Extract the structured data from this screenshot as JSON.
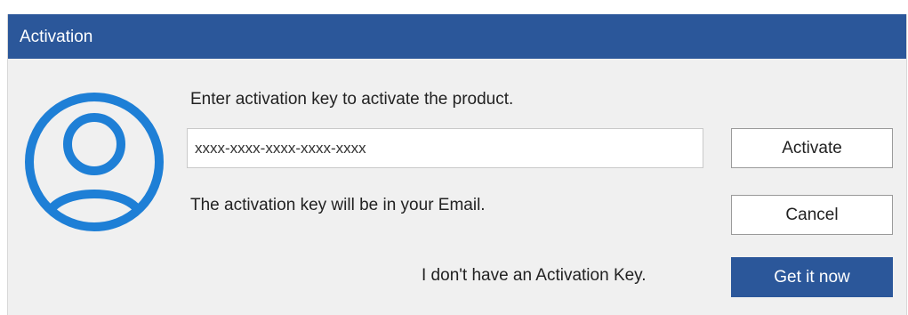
{
  "window": {
    "title": "Activation"
  },
  "icons": {
    "avatar": "user-avatar-icon"
  },
  "content": {
    "prompt": "Enter activation key to activate the product.",
    "key_value": "xxxx-xxxx-xxxx-xxxx-xxxx",
    "info": "The activation key will be in your Email.",
    "no_key": "I don't have an Activation Key."
  },
  "buttons": {
    "activate": "Activate",
    "cancel": "Cancel",
    "get_it_now": "Get it now"
  },
  "colors": {
    "titlebar": "#2b579a",
    "accent_icon": "#1e7fd6",
    "primary_button": "#2b579a"
  }
}
